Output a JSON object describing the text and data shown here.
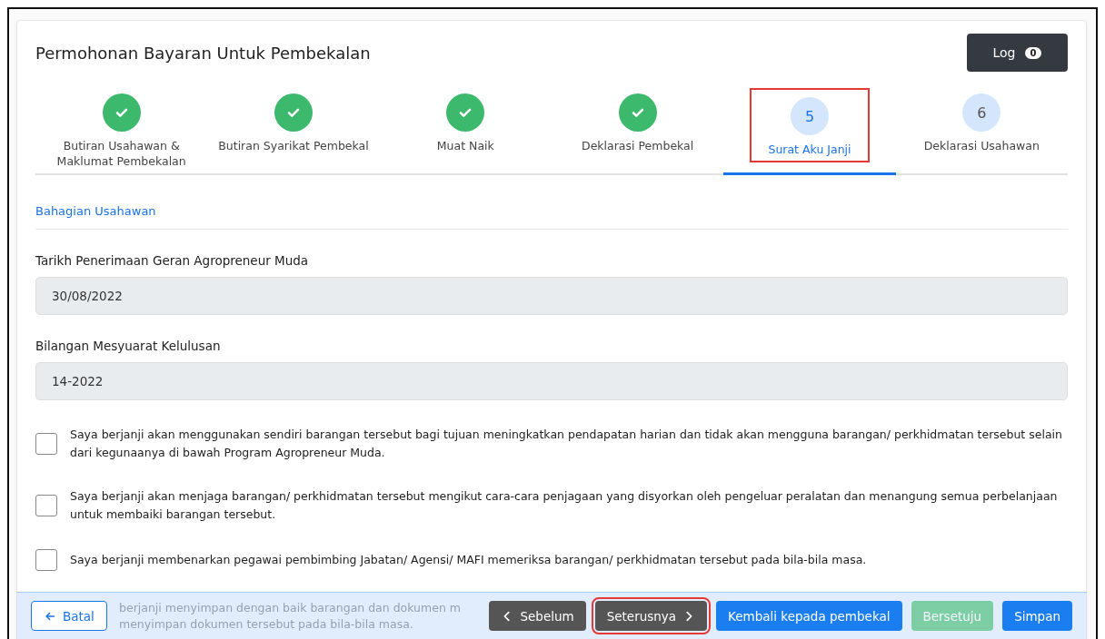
{
  "title": "Permohonan Bayaran Untuk Pembekalan",
  "log_button": {
    "label": "Log",
    "count": "0"
  },
  "steps": [
    {
      "label": "Butiran Usahawan & Maklumat Pembekalan",
      "kind": "done",
      "selected": false,
      "highlighted": false
    },
    {
      "label": "Butiran Syarikat Pembekal",
      "kind": "done",
      "selected": false,
      "highlighted": false
    },
    {
      "label": "Muat Naik",
      "kind": "done",
      "selected": false,
      "highlighted": false
    },
    {
      "label": "Deklarasi Pembekal",
      "kind": "done",
      "selected": false,
      "highlighted": false
    },
    {
      "label": "Surat Aku Janji",
      "number": "5",
      "kind": "numbered",
      "selected": true,
      "highlighted": true
    },
    {
      "label": "Deklarasi Usahawan",
      "number": "6",
      "kind": "numbered",
      "selected": false,
      "highlighted": false
    }
  ],
  "section_title": "Bahagian Usahawan",
  "fields": [
    {
      "label": "Tarikh Penerimaan Geran Agropreneur Muda",
      "value": "30/08/2022",
      "disabled": true
    },
    {
      "label": "Bilangan Mesyuarat Kelulusan",
      "value": "14-2022",
      "disabled": true
    }
  ],
  "pledges": [
    {
      "text": "Saya berjanji akan menggunakan sendiri barangan tersebut bagi tujuan meningkatkan pendapatan harian dan tidak akan mengguna barangan/ perkhidmatan tersebut selain dari kegunaanya di bawah Program Agropreneur Muda.",
      "checked": false
    },
    {
      "text": "Saya berjanji akan menjaga barangan/ perkhidmatan tersebut mengikut cara-cara penjagaan yang disyorkan oleh pengeluar peralatan dan menangung semua perbelanjaan untuk membaiki barangan tersebut.",
      "checked": false
    },
    {
      "text": "Saya berjanji membenarkan pegawai pembimbing Jabatan/ Agensi/ MAFI memeriksa barangan/ perkhidmatan tersebut pada bila-bila masa.",
      "checked": false
    }
  ],
  "covered_pledge": {
    "line_1": "berjanji menyimpan dengan baik barangan dan dokumen m",
    "line_2": "menyimpan dokumen tersebut pada bila-bila masa."
  },
  "footer_buttons": [
    {
      "label": "Batal",
      "kind": "back",
      "disabled": false,
      "highlighted": false
    },
    {
      "label": "Sebelum",
      "kind": "prev",
      "disabled": false,
      "highlighted": false
    },
    {
      "label": "Seterusnya",
      "kind": "next",
      "disabled": false,
      "highlighted": true
    },
    {
      "label": "Kembali kepada pembekal",
      "kind": "primary",
      "disabled": false,
      "highlighted": false
    },
    {
      "label": "Bersetuju",
      "kind": "success",
      "disabled": true,
      "highlighted": false
    },
    {
      "label": "Simpan",
      "kind": "primary",
      "disabled": false,
      "highlighted": false
    }
  ]
}
